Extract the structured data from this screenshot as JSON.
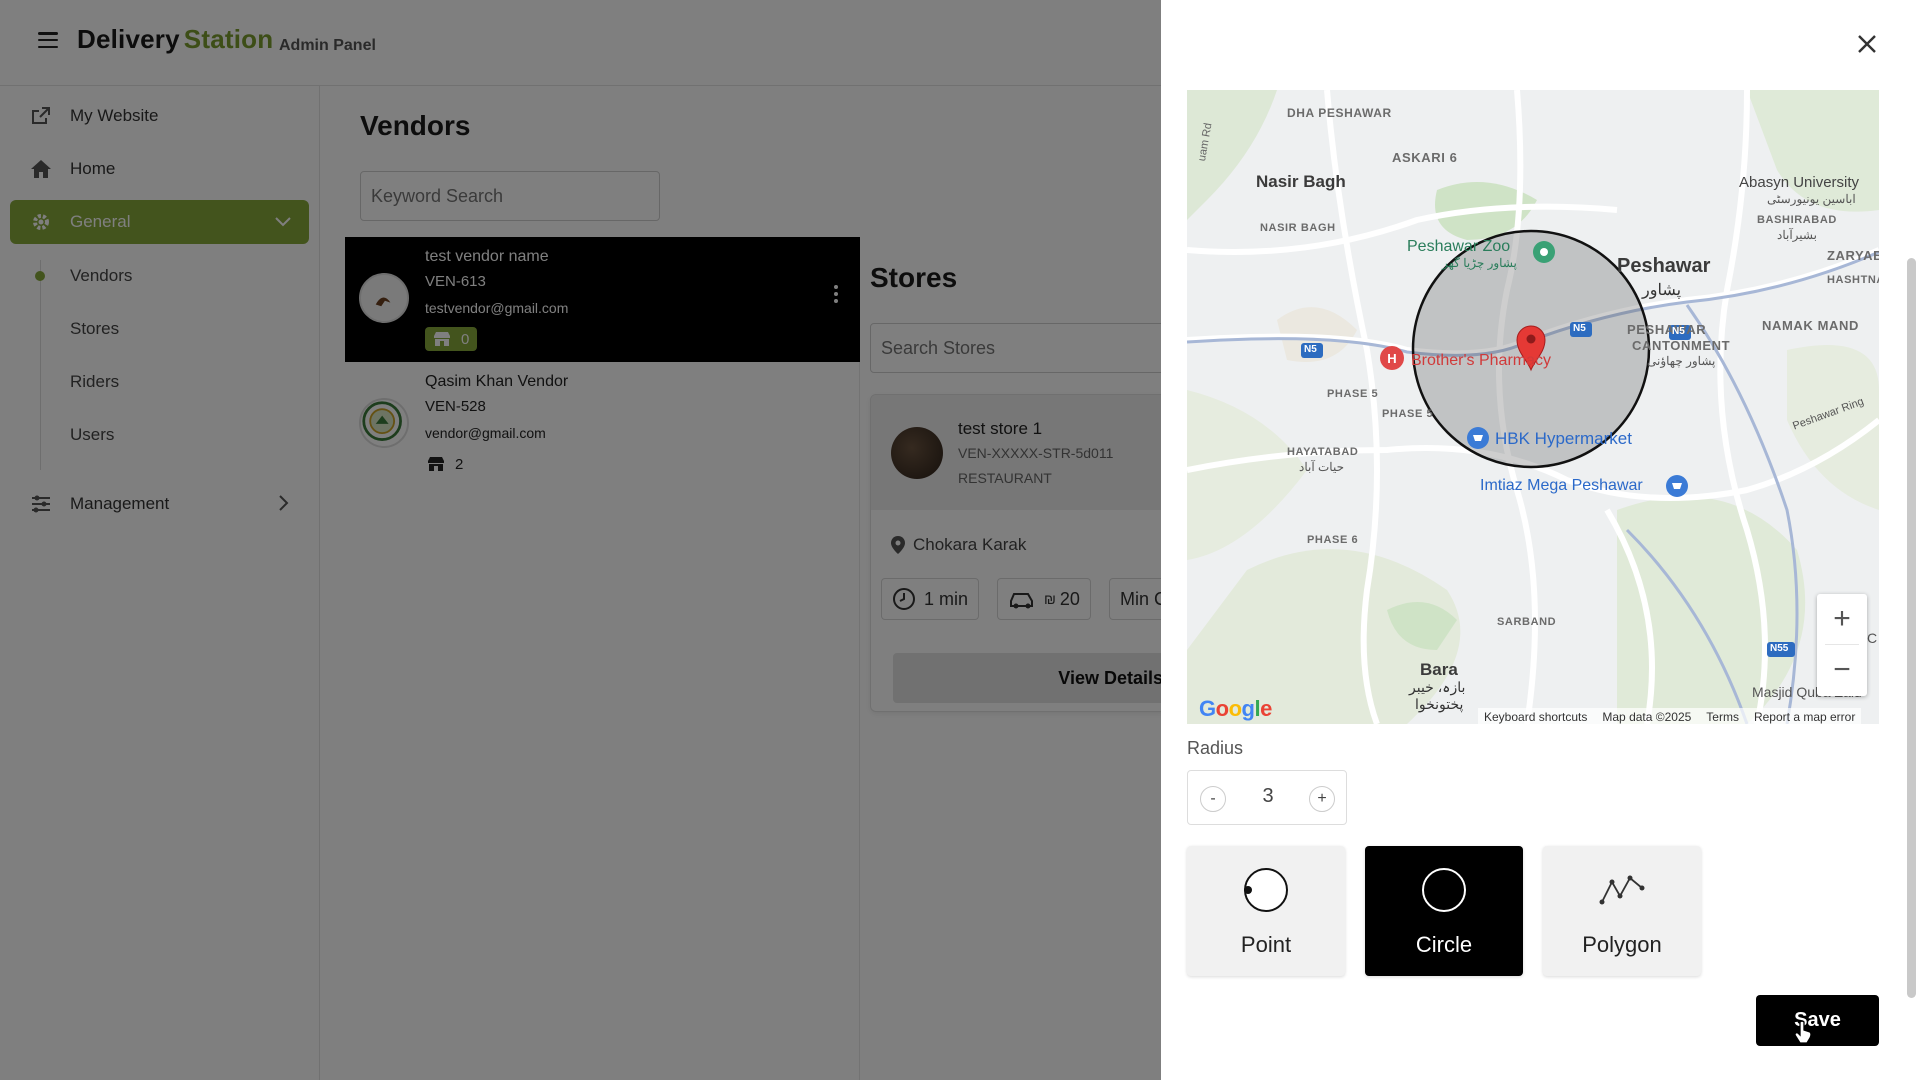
{
  "header": {
    "brand_primary": "Delivery",
    "brand_secondary": "Station",
    "subtitle": "Admin Panel",
    "brand_accent": "#7a9c2f"
  },
  "sidebar": {
    "items": [
      {
        "label": "My Website",
        "icon": "external-link-icon"
      },
      {
        "label": "Home",
        "icon": "home-icon"
      },
      {
        "label": "General",
        "icon": "gear-icon",
        "active": true
      },
      {
        "label": "Management",
        "icon": "sliders-icon"
      }
    ],
    "general_sub": [
      "Vendors",
      "Stores",
      "Riders",
      "Users"
    ]
  },
  "vendors": {
    "title": "Vendors",
    "search_placeholder": "Keyword Search",
    "list": [
      {
        "name": "test vendor name",
        "code": "VEN-613",
        "email": "testvendor@gmail.com",
        "stores": "0",
        "selected": true
      },
      {
        "name": "Qasim Khan Vendor",
        "code": "VEN-528",
        "email": "vendor@gmail.com",
        "stores": "2",
        "selected": false
      }
    ]
  },
  "stores": {
    "title": "Stores",
    "search_placeholder": "Search Stores",
    "card": {
      "name": "test store 1",
      "code": "VEN-XXXXX-STR-5d011",
      "type": "RESTAURANT",
      "location": "Chokara Karak",
      "time": "1 min",
      "fee_currency": "₪",
      "fee": "20",
      "min_label": "Min C",
      "view_button": "View Details"
    }
  },
  "map": {
    "labels": {
      "dha": "DHA PESHAWAR",
      "askari": "ASKARI 6",
      "nasir_bagh": "Nasir Bagh",
      "nasir_bagh_small": "NASIR BAGH",
      "zoo": "Peshawar Zoo",
      "zoo_urdu": "پشاور چڑیا گھر",
      "peshawar": "Peshawar",
      "peshawar_urdu": "پشاور",
      "cantonment": "PESHAWAR",
      "cantonment2": "CANTONMENT",
      "cantonment_urdu": "پشاور چھاؤنی",
      "abasyn": "Abasyn University",
      "abasyn_urdu": "اباسین یونیورسٹی",
      "bashirabad": "BASHIRABAD",
      "bashirabad_urdu": "بشیرآباد",
      "zaryab": "ZARYAB",
      "hashtnagri": "HASHTNA",
      "namak": "NAMAK MAND",
      "pharmacy": "Brother's Pharmacy",
      "phase5": "PHASE 5",
      "phase5b": "PHASE 5",
      "hayatabad": "HAYATABAD",
      "hayatabad_urdu": "حیات آباد",
      "hbk": "HBK Hypermarket",
      "imtiaz": "Imtiaz Mega Peshawar",
      "phase6": "PHASE 6",
      "sarband": "SARBAND",
      "bara": "Bara",
      "bara_urdu1": "بازہ، خیبر",
      "bara_urdu2": "پختونخوا",
      "masjid": "Masjid Quba Zaid",
      "peshawar_ring": "Peshawar Ring",
      "n5a": "N5",
      "n5b": "N5",
      "n5c": "N5",
      "n55": "N55",
      "road_left": "uam Rd",
      "c_edge": "C"
    },
    "google": "Google",
    "footer": [
      "Keyboard shortcuts",
      "Map data ©2025",
      "Terms",
      "Report a map error"
    ],
    "zoom_in": "+",
    "zoom_out": "−"
  },
  "radius": {
    "label": "Radius",
    "value": "3",
    "minus": "-",
    "plus": "+"
  },
  "shapes": [
    {
      "label": "Point",
      "active": false,
      "icon": "point-icon"
    },
    {
      "label": "Circle",
      "active": true,
      "icon": "circle-icon"
    },
    {
      "label": "Polygon",
      "active": false,
      "icon": "polygon-icon"
    }
  ],
  "save_label": "Save"
}
